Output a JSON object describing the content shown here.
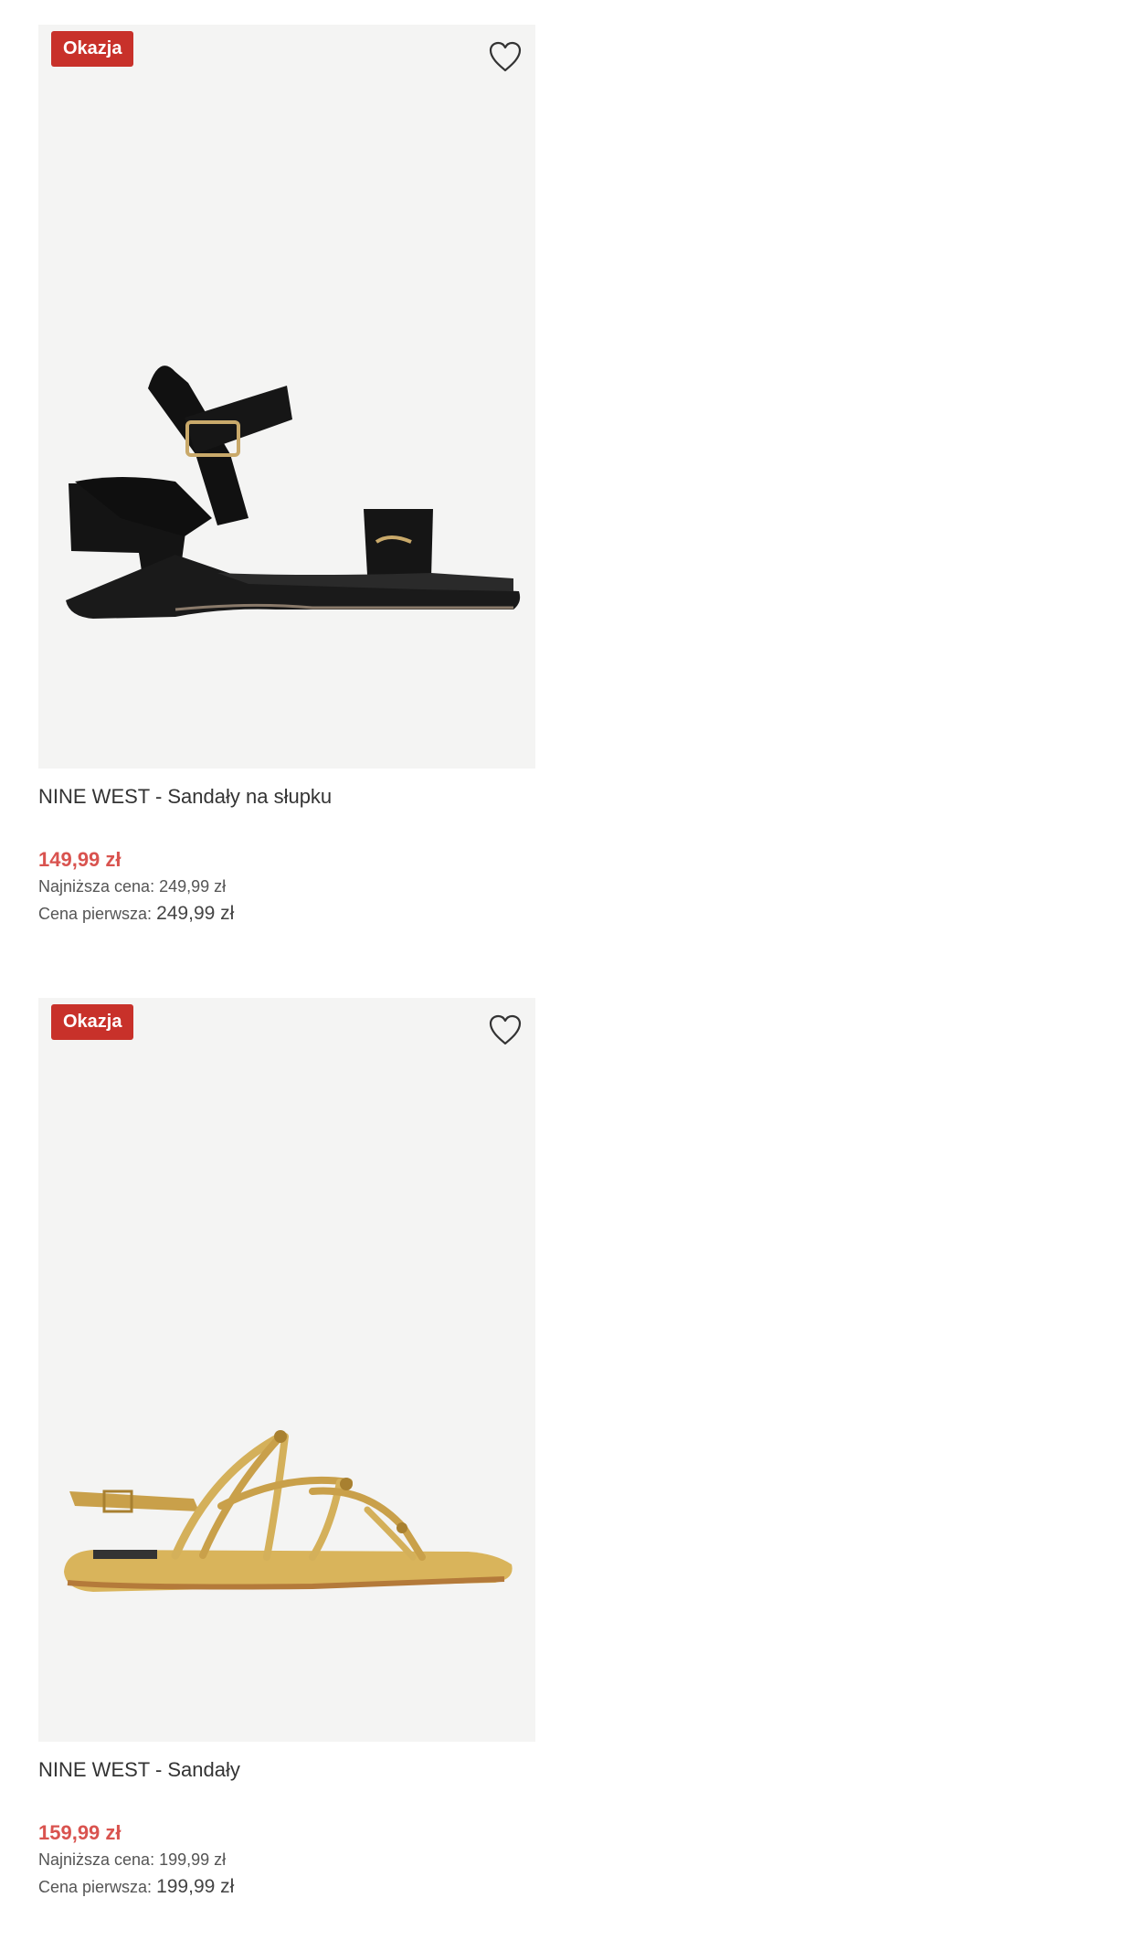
{
  "products": [
    {
      "badge": "Okazja",
      "title": "NINE WEST - Sandały na słupku",
      "price": "149,99 zł",
      "lowest_label": "Najniższa cena:",
      "lowest_value": "249,99 zł",
      "original_label": "Cena pierwsza:",
      "original_value": "249,99 zł",
      "image": "black block-heel sandal",
      "icon": "heart-outline-icon"
    },
    {
      "badge": "Okazja",
      "title": "NINE WEST - Sandały",
      "price": "159,99 zł",
      "lowest_label": "Najniższa cena:",
      "lowest_value": "199,99 zł",
      "original_label": "Cena pierwsza:",
      "original_value": "199,99 zł",
      "image": "gold strappy flat sandal",
      "icon": "heart-outline-icon"
    }
  ],
  "colors": {
    "badge": "#c8312a",
    "price": "#d9534f",
    "image_bg": "#f4f4f3"
  }
}
